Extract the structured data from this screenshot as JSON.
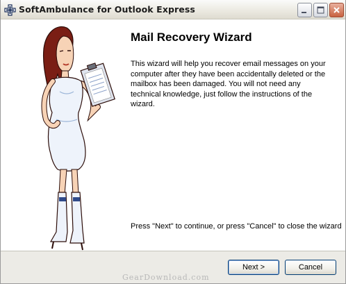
{
  "window": {
    "title": "SoftAmbulance for Outlook Express",
    "colors": {
      "titlebar": "#ece9d8",
      "close_button": "#c86240",
      "button_border": "#003c74"
    }
  },
  "icons": {
    "app": "ambulance-cross-icon",
    "minimize": "minimize-icon",
    "maximize": "maximize-icon",
    "close": "close-icon"
  },
  "wizard": {
    "heading": "Mail Recovery Wizard",
    "description": "This wizard will help you recover email messages on your computer after they have been accidentally deleted or the mailbox has been damaged. You will not need any technical knowledge, just follow the instructions of the wizard.",
    "footer_hint": "Press \"Next\" to continue, or press \"Cancel\" to close the wizard"
  },
  "buttons": {
    "next": "Next >",
    "cancel": "Cancel"
  },
  "watermark": "GearDownload.com"
}
